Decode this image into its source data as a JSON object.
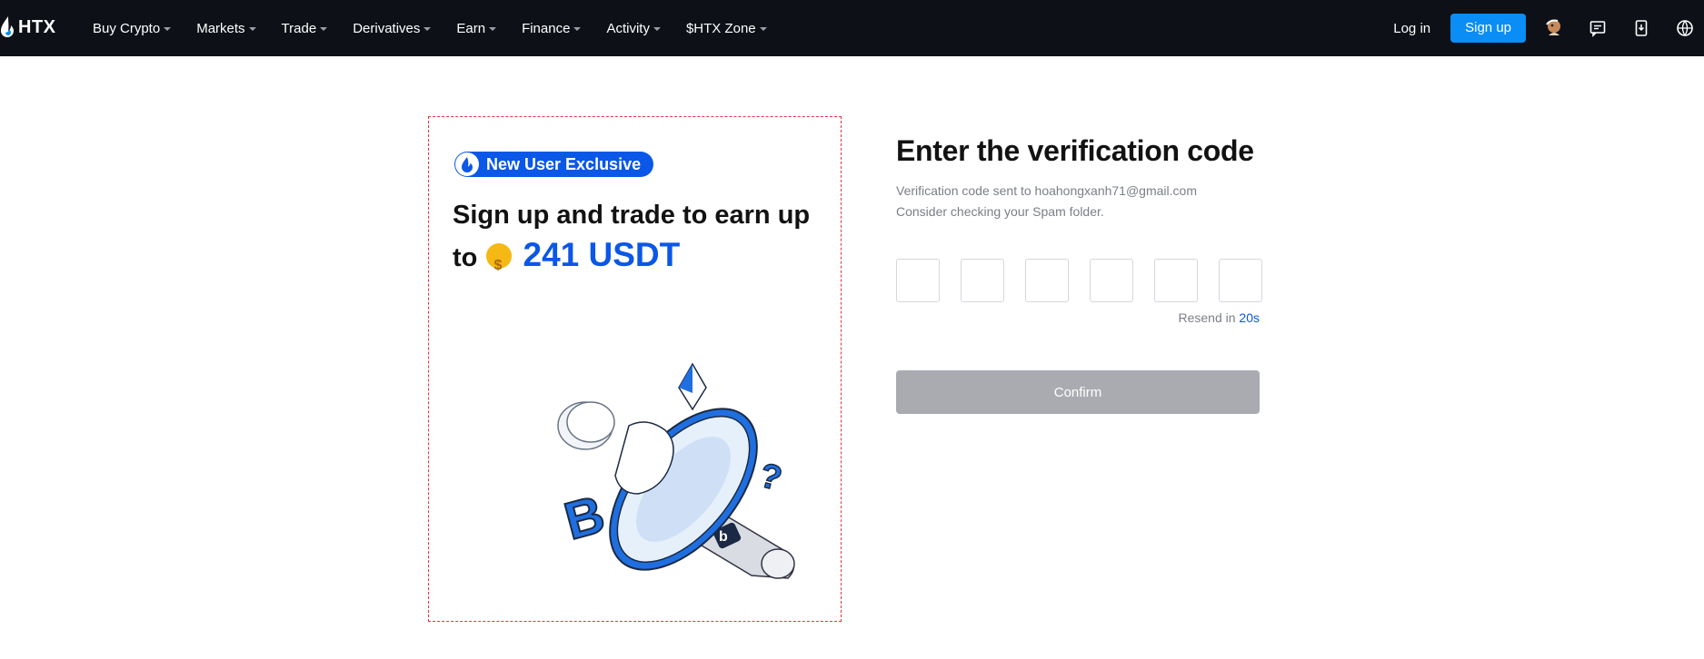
{
  "brand": {
    "name": "HTX",
    "accent": "#0a8ef5"
  },
  "nav": {
    "menu": [
      {
        "label": "Buy Crypto"
      },
      {
        "label": "Markets"
      },
      {
        "label": "Trade"
      },
      {
        "label": "Derivatives"
      },
      {
        "label": "Earn"
      },
      {
        "label": "Finance"
      },
      {
        "label": "Activity"
      },
      {
        "label": "$HTX Zone"
      }
    ],
    "login": "Log in",
    "signup": "Sign up",
    "icons": [
      "avatar-icon",
      "message-icon",
      "download-icon",
      "globe-icon"
    ]
  },
  "promo": {
    "badge": "New User Exclusive",
    "title_part1": "Sign up and trade to earn up to",
    "amount": "241 USDT"
  },
  "verify": {
    "title": "Enter the verification code",
    "sent_to": "Verification code sent to hoahongxanh71@gmail.com",
    "spam_hint": "Consider checking your Spam folder.",
    "resend_label": "Resend in",
    "resend_timer": "20s",
    "confirm": "Confirm"
  }
}
